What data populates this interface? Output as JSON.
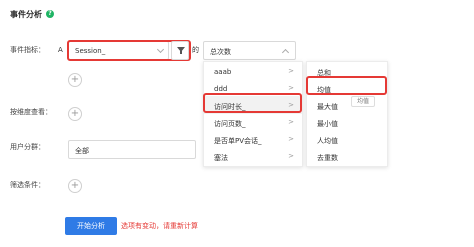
{
  "header": {
    "title": "事件分析",
    "help_icon": "?"
  },
  "labels": {
    "event_metric": "事件指标：",
    "group_by": "按维度查看：",
    "user_group": "用户分群：",
    "filter": "筛选条件："
  },
  "metric_row": {
    "letter": "A",
    "event_value": "Session_",
    "connector": "的",
    "aggregate_value": "总次数"
  },
  "user_group_value": "全部",
  "add_icon": "+",
  "property_menu": {
    "items": [
      {
        "label": "aaab",
        "has_submenu": true
      },
      {
        "label": "ddd",
        "has_submenu": true
      },
      {
        "label": "访问时长_",
        "has_submenu": true
      },
      {
        "label": "访问页数_",
        "has_submenu": true
      },
      {
        "label": "是否单PV会话_",
        "has_submenu": true
      },
      {
        "label": "塞法",
        "has_submenu": true
      }
    ],
    "arrow": ">"
  },
  "aggregate_menu": {
    "items": [
      "总和",
      "均值",
      "最大值",
      "最小值",
      "人均值",
      "去重数"
    ]
  },
  "tooltip": "均值",
  "actions": {
    "start_label": "开始分析",
    "warning": "选项有变动，请重新计算"
  },
  "colors": {
    "accent": "#2f7be6",
    "highlight_border": "#e53935",
    "help_icon": "#1fb464"
  }
}
